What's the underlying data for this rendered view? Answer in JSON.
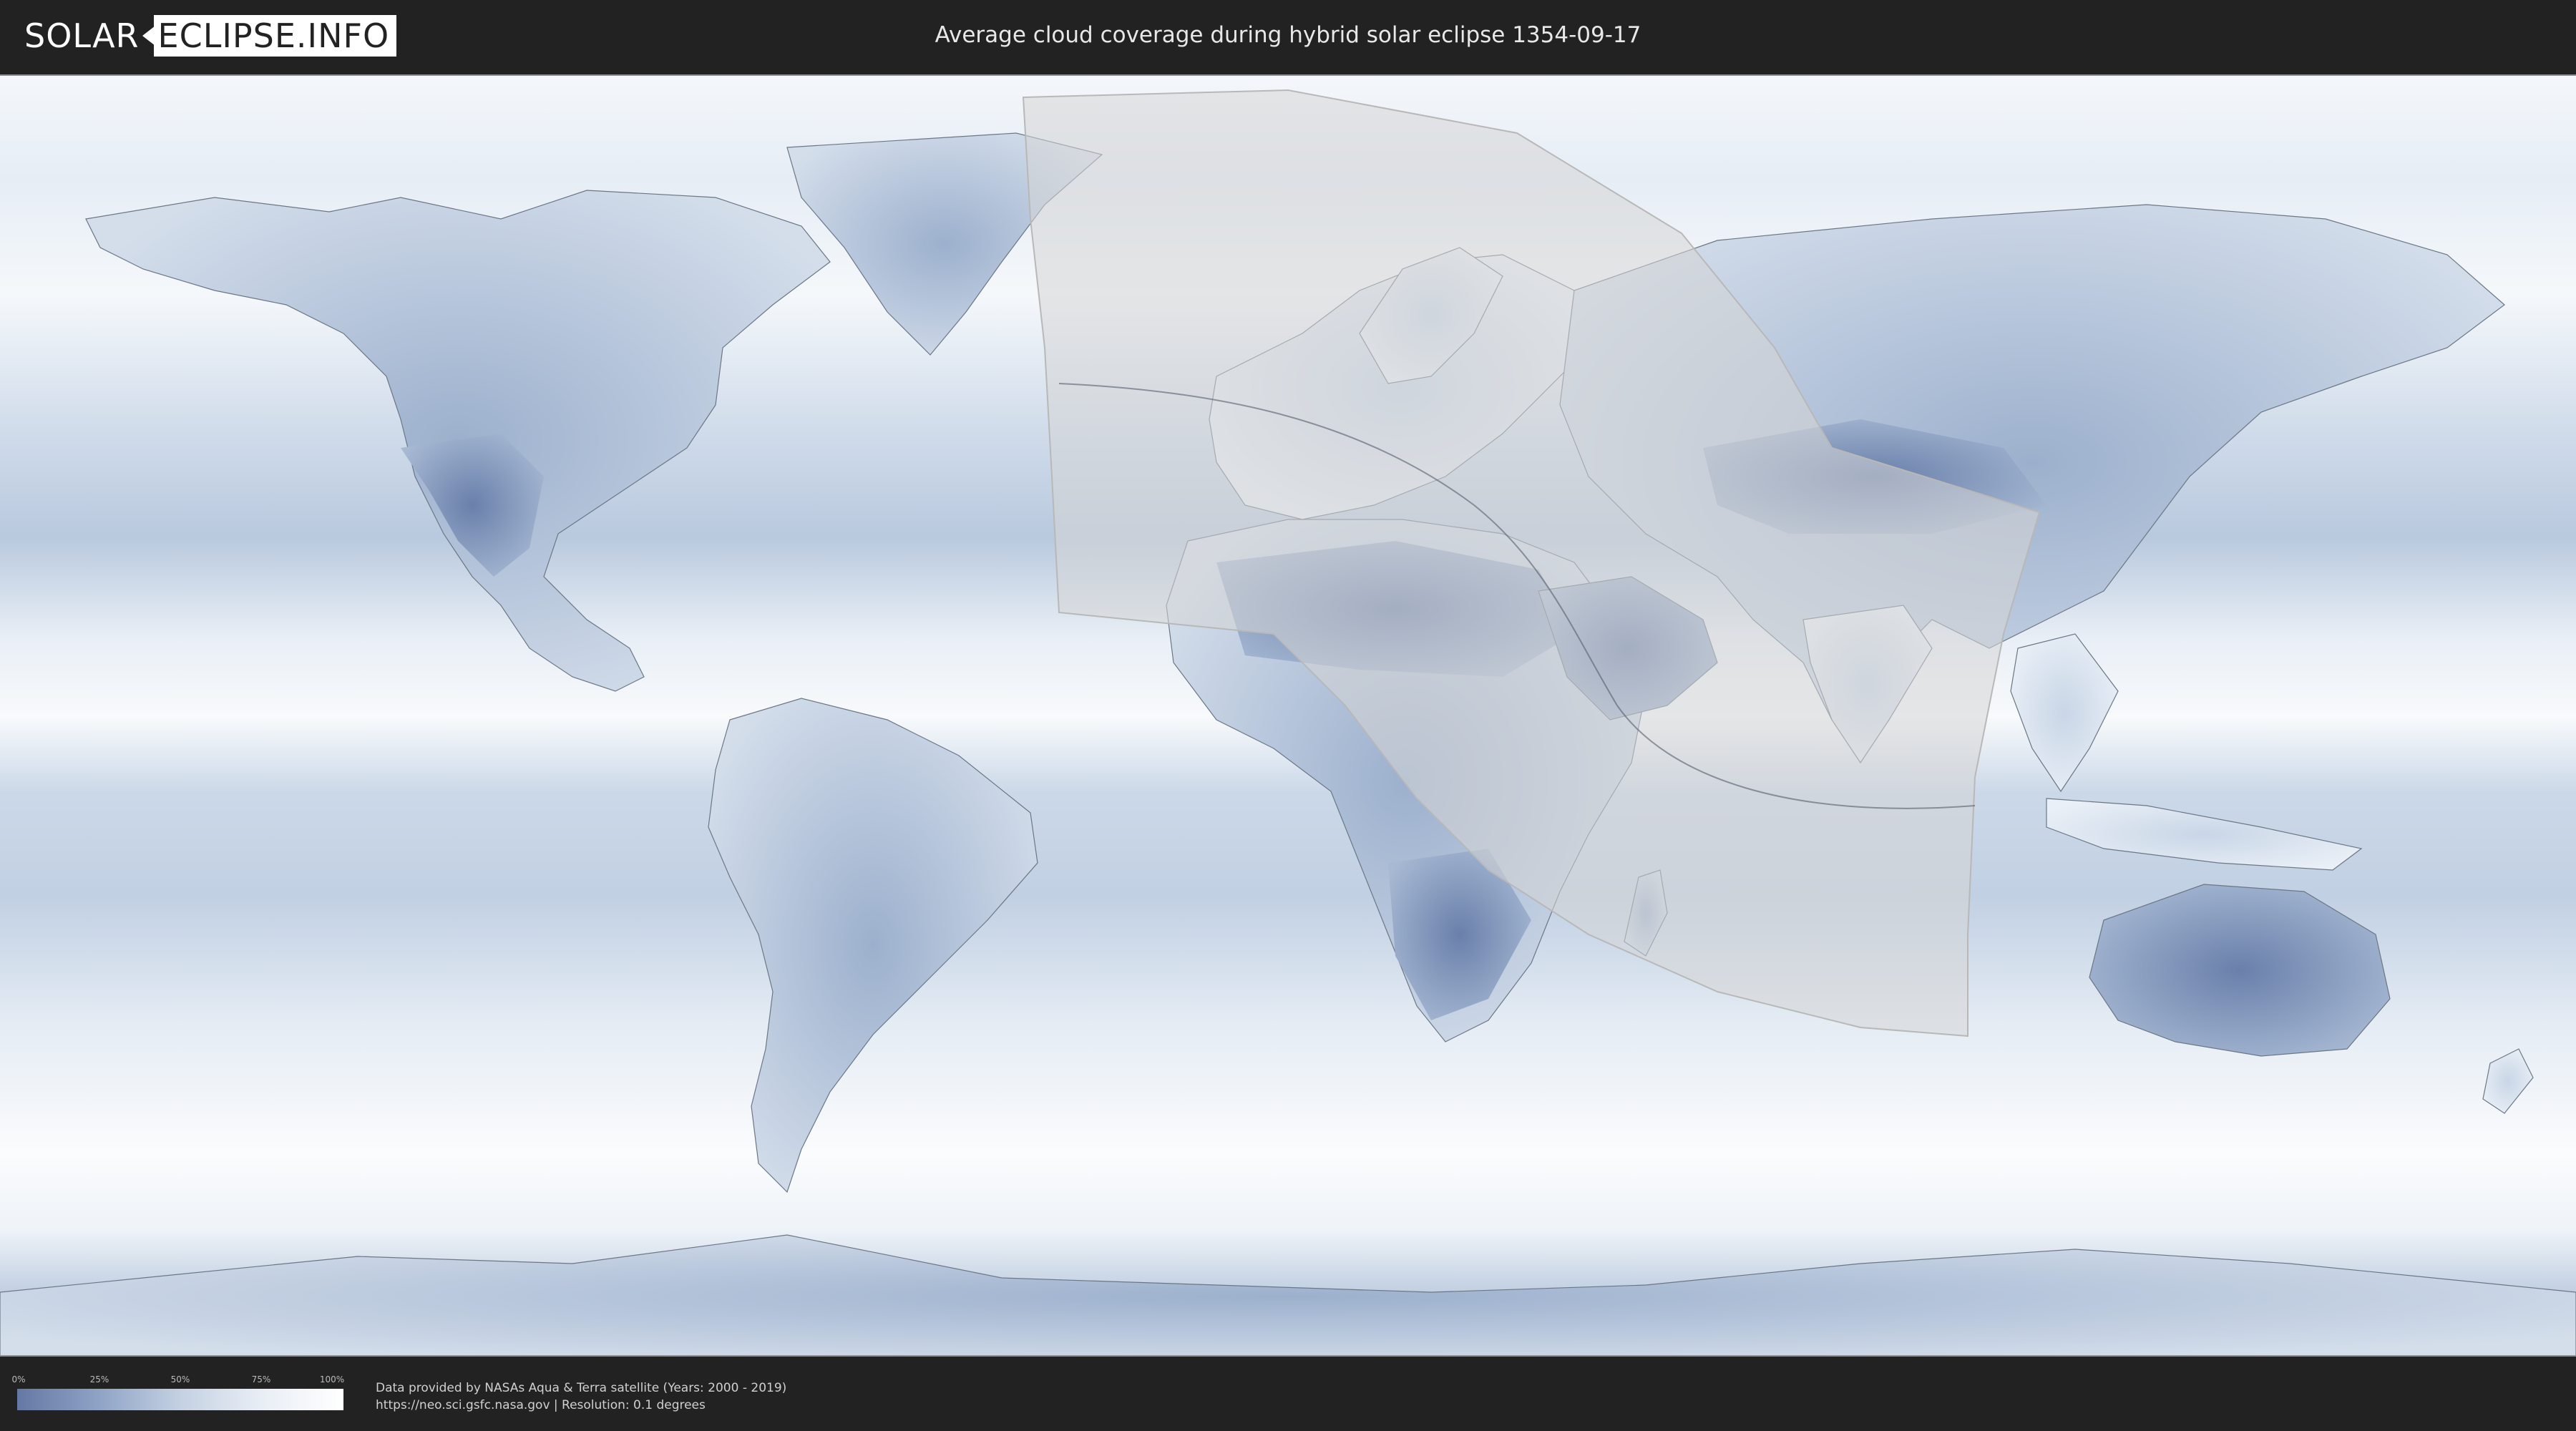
{
  "header": {
    "logo_part1": "SOLAR",
    "logo_part2": "ECLIPSE.INFO",
    "title": "Average cloud coverage during hybrid solar eclipse 1354-09-17"
  },
  "map": {
    "type": "equirectangular world map",
    "layer": "average cloud coverage",
    "overlay": "eclipse visibility zone with central path line",
    "colors": {
      "clear": "#6478a4",
      "cloudy": "#ffffff",
      "overlay": "#d8d8d8",
      "coastline": "#6b7785"
    }
  },
  "legend": {
    "ticks": [
      "0%",
      "25%",
      "50%",
      "75%",
      "100%"
    ],
    "tick_values": [
      0,
      25,
      50,
      75,
      100
    ]
  },
  "footer": {
    "credit_line1": "Data provided by NASAs Aqua & Terra satellite (Years: 2000 - 2019)",
    "credit_line2": "https://neo.sci.gsfc.nasa.gov | Resolution: 0.1 degrees"
  }
}
